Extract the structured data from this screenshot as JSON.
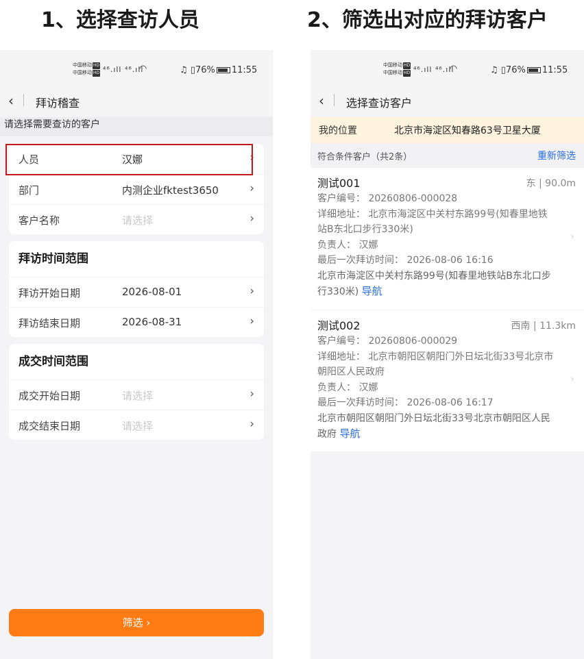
{
  "titles": {
    "left": "1、选择查访人员",
    "right": "2、筛选出对应的拜访客户"
  },
  "statusbar": {
    "carrier1": "中国移动",
    "carrier2": "中国移动",
    "hd": "HD",
    "signal": "⁴⁶.ıll ⁴⁶.ıll",
    "battery_pct": "76%",
    "time": "11:55"
  },
  "left": {
    "nav_title": "拜访稽查",
    "hint": "请选择需要查访的客户",
    "basic_rows": [
      {
        "label": "人员",
        "value": "汉娜",
        "placeholder": false
      },
      {
        "label": "部门",
        "value": "内测企业fktest3650",
        "placeholder": false
      },
      {
        "label": "客户名称",
        "value": "请选择",
        "placeholder": true
      }
    ],
    "visit_section": {
      "heading": "拜访时间范围",
      "rows": [
        {
          "label": "拜访开始日期",
          "value": "2026-08-01"
        },
        {
          "label": "拜访结束日期",
          "value": "2026-08-31"
        }
      ]
    },
    "deal_section": {
      "heading": "成交时间范围",
      "rows": [
        {
          "label": "成交开始日期",
          "value": "请选择"
        },
        {
          "label": "成交结束日期",
          "value": "请选择"
        }
      ]
    },
    "filter_button": "筛选 ›"
  },
  "right": {
    "nav_title": "选择查访客户",
    "location_label": "我的位置",
    "location_value": "北京市海淀区知春路63号卫星大厦",
    "result_count": "符合条件客户（共2条）",
    "refilter": "重新筛选",
    "customers": [
      {
        "name": "测试001",
        "distance": "东 | 90.0m",
        "code_label": "客户编号：",
        "code": "20260806-000028",
        "addr_label": "详细地址：",
        "addr_l1": "北京市海淀区中关村东路99号(知春里地铁",
        "addr_l2": "站B东北口步行330米)",
        "owner_label": "负责人：",
        "owner": "汉娜",
        "last_label": "最后一次拜访时间：",
        "last": "2026-08-06 16:16",
        "loc_l1": "北京市海淀区中关村东路99号(知春里地铁站B东北口步",
        "loc_l2": "行330米)",
        "nav": "导航"
      },
      {
        "name": "测试002",
        "distance": "西南 | 11.3km",
        "code_label": "客户编号：",
        "code": "20260806-000029",
        "addr_label": "详细地址：",
        "addr_l1": "北京市朝阳区朝阳门外日坛北街33号北京市",
        "addr_l2": "朝阳区人民政府",
        "owner_label": "负责人：",
        "owner": "汉娜",
        "last_label": "最后一次拜访时间：",
        "last": "2026-08-06 16:17",
        "loc_l1": "北京市朝阳区朝阳门外日坛北街33号北京市朝阳区人民",
        "loc_l2": "政府",
        "nav": "导航"
      }
    ]
  },
  "colors": {
    "accent_orange": "#ff7b14",
    "link_blue": "#2a6ee0",
    "highlight_red": "#c0181b",
    "location_bg": "#fdf3df"
  }
}
